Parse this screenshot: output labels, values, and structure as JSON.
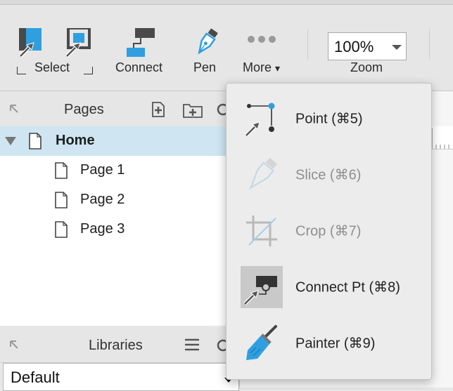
{
  "toolbar": {
    "select_label": "Select",
    "connect_label": "Connect",
    "pen_label": "Pen",
    "more_label": "More",
    "more_caret": "▾",
    "zoom_value": "100%",
    "zoom_label": "Zoom"
  },
  "pages_panel": {
    "title": "Pages",
    "items": [
      {
        "label": "Home",
        "selected": true
      },
      {
        "label": "Page 1"
      },
      {
        "label": "Page 2"
      },
      {
        "label": "Page 3"
      }
    ]
  },
  "libraries_panel": {
    "title": "Libraries",
    "selected_value": "Default"
  },
  "more_menu": {
    "items": [
      {
        "label": "Point (⌘5)",
        "icon": "point-tool-icon",
        "enabled": true
      },
      {
        "label": "Slice (⌘6)",
        "icon": "slice-tool-icon",
        "enabled": false
      },
      {
        "label": "Crop (⌘7)",
        "icon": "crop-tool-icon",
        "enabled": false
      },
      {
        "label": "Connect Pt (⌘8)",
        "icon": "connect-point-tool-icon",
        "enabled": true,
        "active": true
      },
      {
        "label": "Painter (⌘9)",
        "icon": "painter-tool-icon",
        "enabled": true
      }
    ]
  },
  "colors": {
    "accent_blue": "#2f9fe0",
    "selection_bg": "#cfe6f2",
    "icon_dark": "#4a4a4a",
    "menu_bg": "#ececec"
  }
}
